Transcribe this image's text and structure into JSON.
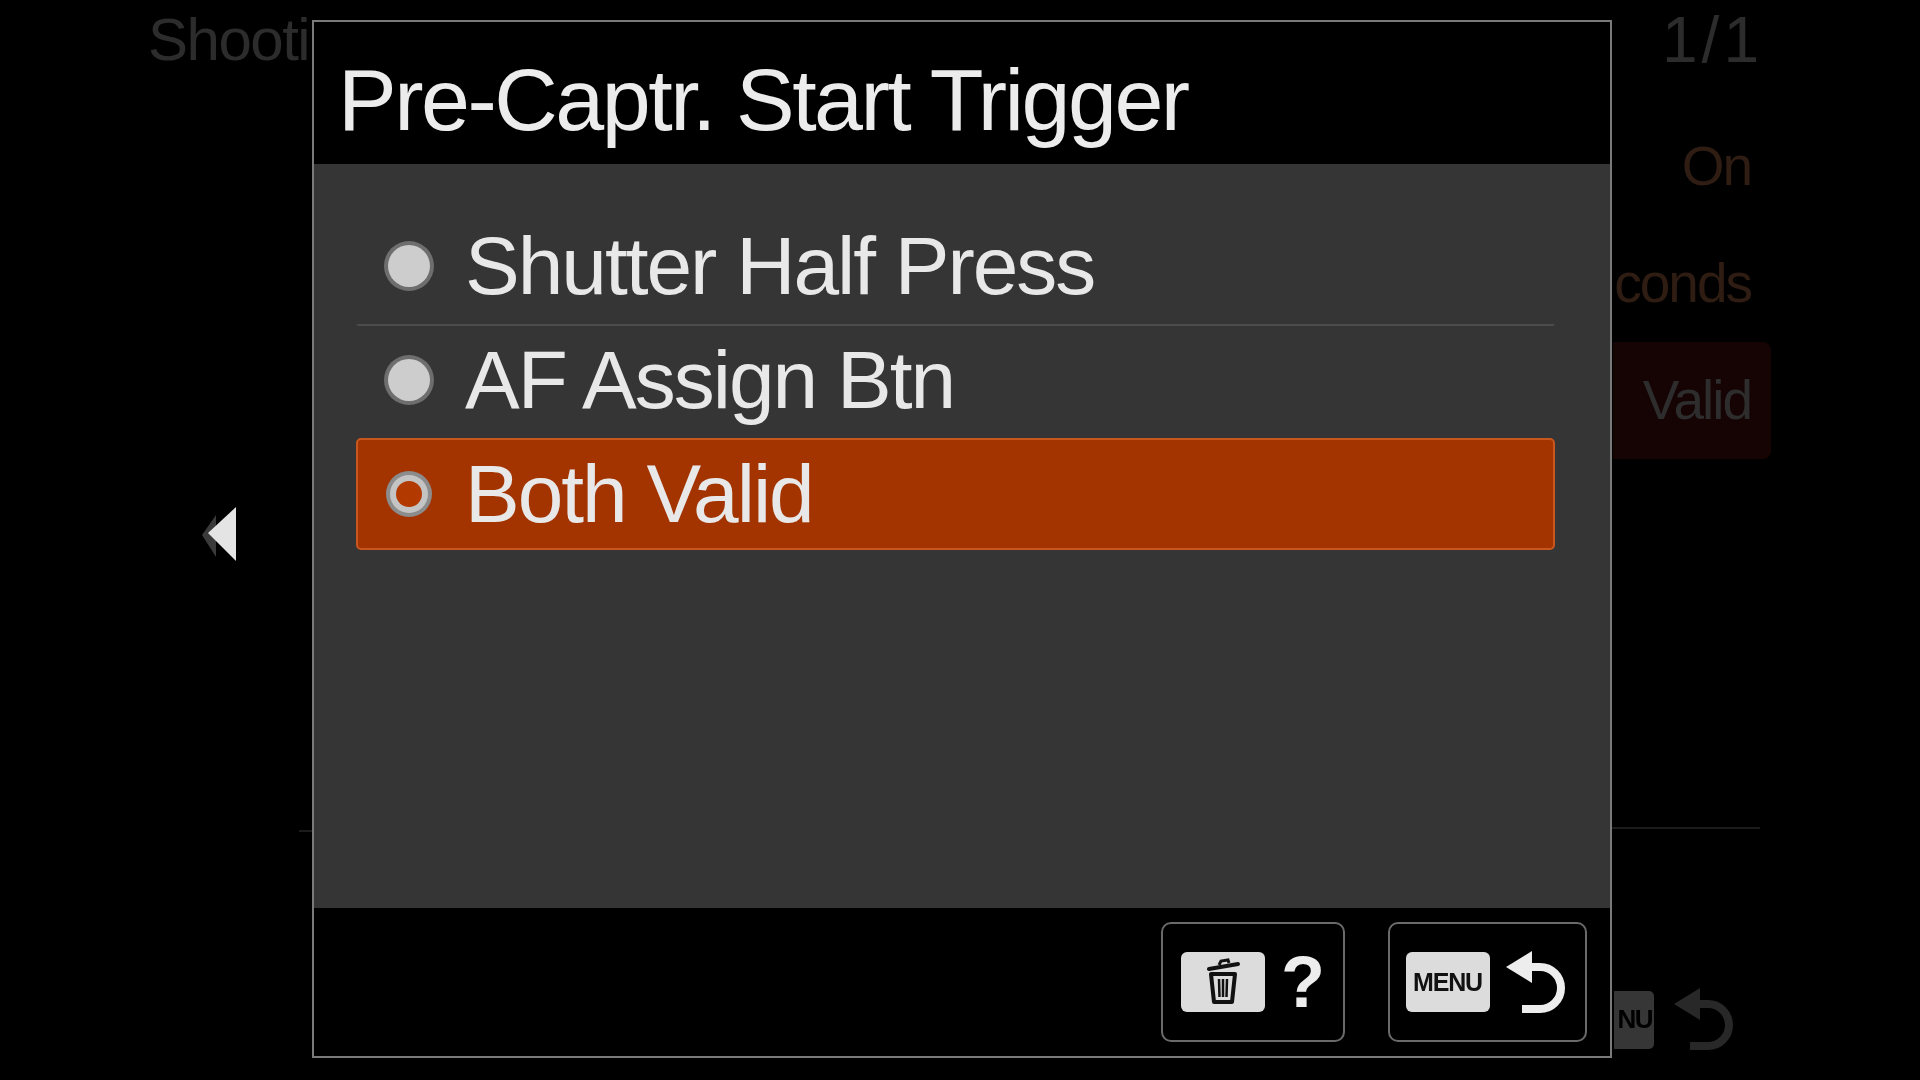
{
  "background_menu": {
    "title": "Shooti",
    "page": "1/1",
    "rows": [
      {
        "value": "On",
        "selected": false
      },
      {
        "value": "conds",
        "selected": false
      },
      {
        "value": "Valid",
        "selected": true
      }
    ],
    "back_key_label": "NU"
  },
  "dialog": {
    "title": "Pre-Captr. Start Trigger",
    "options": [
      {
        "label": "Shutter Half Press",
        "selected": false
      },
      {
        "label": "AF Assign Btn",
        "selected": false
      },
      {
        "label": "Both Valid",
        "selected": true
      }
    ],
    "buttons": [
      {
        "kind": "help",
        "label": "?"
      },
      {
        "kind": "back",
        "key_label": "MENU"
      }
    ]
  }
}
